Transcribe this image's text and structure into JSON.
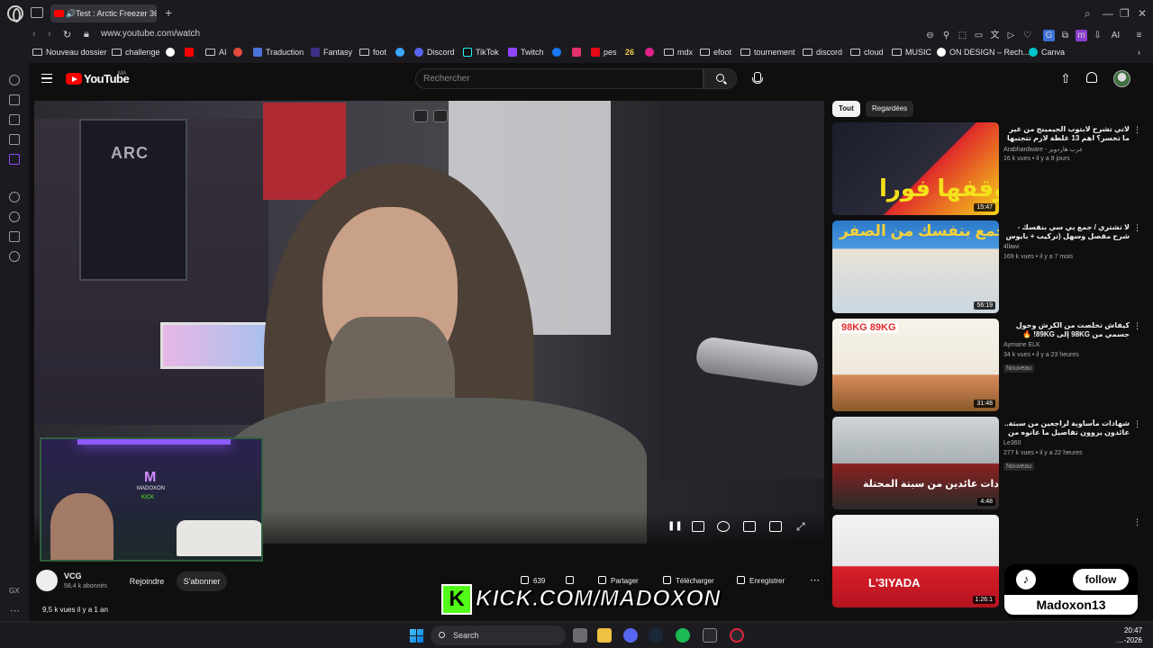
{
  "browser": {
    "tab_title": "Test : Arctic Freezer 36",
    "url": "www.youtube.com/watch",
    "bookmarks": [
      "Nouveau dossier",
      "challenge",
      "AI",
      "Traduction",
      "Fantasy",
      "foot",
      "Discord",
      "TikTok",
      "Twitch",
      "pes",
      "26",
      "mdx",
      "efoot",
      "tournement",
      "discord",
      "cloud",
      "MUSIC",
      "ON DESIGN – Rech...",
      "Canva"
    ],
    "sidebar_label": "GX"
  },
  "youtube": {
    "brand": "YouTube",
    "country": "MA",
    "search_placeholder": "Rechercher",
    "chips": [
      "Tout",
      "Regardées"
    ]
  },
  "video": {
    "scene_text": "ARC",
    "channel_name": "VCG",
    "subscribers": "58,4 k abonnés",
    "join_label": "Rejoindre",
    "subscribe_label": "S'abonner",
    "likes": "639",
    "share_label": "Partager",
    "download_label": "Télécharger",
    "save_label": "Enregistrer",
    "views_line": "9,5 k vues  il y a 1 an"
  },
  "overlays": {
    "webcam_logo": "M",
    "webcam_name": "MADOXON",
    "webcam_kick": "KICK",
    "kick_letter": "K",
    "kick_url": "KICK.COM/MADOXON",
    "tiktok_follow": "follow",
    "tiktok_name": "Madoxon13"
  },
  "recommendations": [
    {
      "title": "لاتي تشرح لابتوب الجيمينج من غير ما تخسر؟ اهم 13 غلطة لازم تتجنبها ❌",
      "channel": "Arabhardware - عرب هاردوير",
      "meta": "16 k vues • il y a 8 jours",
      "duration": "15:47",
      "thumb_text": "وقفها فورا",
      "badge": "",
      "colors": [
        "#1b1d2c",
        "#e02a2a"
      ]
    },
    {
      "title": "لا تشتري / جمع بي سي بنفسك - شرح مفصل وسهل (تركيب + بايوس + ويندوز + تعريفات + ...",
      "channel": "4llawi",
      "meta": "169 k vues • il y a 7 mois",
      "duration": "56:19",
      "thumb_text": "جمع بنفسك من الصفر",
      "badge": "",
      "colors": [
        "#2a78c8",
        "#f3b4a0"
      ]
    },
    {
      "title": "كيفاش تخلصت من الكرش وحول جسمي من 98KG إلى 89KG! 🔥 (تجربتي الحقيقية)",
      "channel": "Aymane ELK",
      "meta": "34 k vues • il y a 23 heures",
      "duration": "31:48",
      "thumb_text": "98KG  89KG",
      "badge": "Nouveau",
      "colors": [
        "#f7f3ea",
        "#d88a5c"
      ]
    },
    {
      "title": "شهادات مأساوية لراجعين من سبتة.. عائدون يروون تفاصيل ما عانوه من جحيم بشوارع ...",
      "channel": "Le360",
      "meta": "277 k vues • il y a 22 heures",
      "duration": "4:48",
      "thumb_text": "شهادات عائدين من سبتة المحتلة",
      "badge": "Nouveau",
      "colors": [
        "#cfd5d8",
        "#8a2020"
      ]
    },
    {
      "title": "",
      "channel": "",
      "meta": "",
      "duration": "1:26:1",
      "thumb_text": "L'3IYADA",
      "badge": "",
      "colors": [
        "#f2f2f2",
        "#d91e2a"
      ]
    }
  ],
  "taskbar": {
    "search_label": "Search",
    "time": "20:47",
    "date": "…-2026"
  }
}
